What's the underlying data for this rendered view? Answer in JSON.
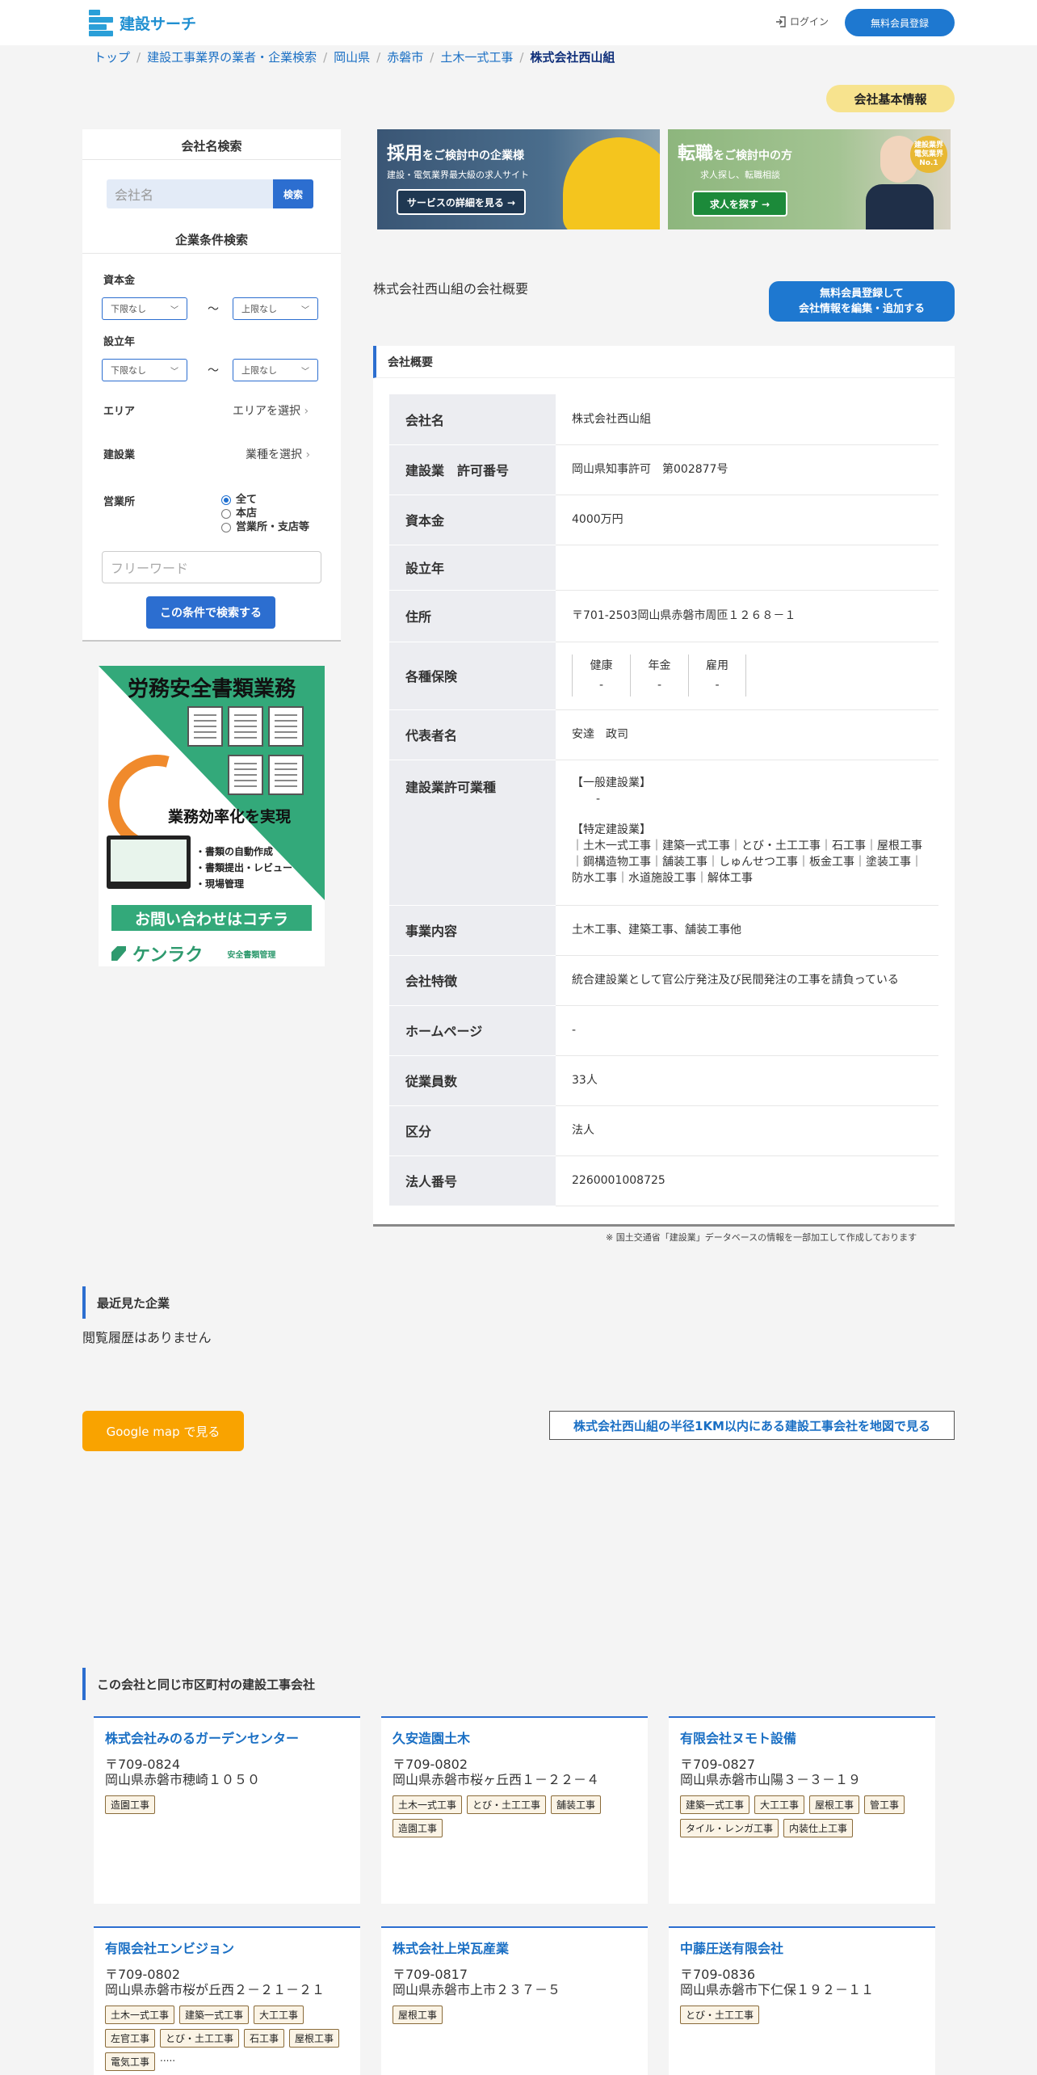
{
  "header": {
    "logo_text": "建設サーチ",
    "login_label": "ログイン",
    "register_label": "無料会員登録"
  },
  "breadcrumb": [
    "トップ",
    "建設工事業界の業者・企業検索",
    "岡山県",
    "赤磐市",
    "土木一式工事",
    "株式会社西山組"
  ],
  "info_pill": "会社基本情報",
  "sidebar": {
    "name_search_title": "会社名検索",
    "name_placeholder": "会社名",
    "name_search_btn": "検索",
    "cond_title": "企業条件検索",
    "capital_label": "資本金",
    "founded_label": "設立年",
    "lower_default": "下限なし",
    "upper_default": "上限なし",
    "tilde": "〜",
    "area_label": "エリア",
    "area_pick": "エリアを選択",
    "industry_label": "建設業",
    "industry_pick": "業種を選択",
    "office_label": "営業所",
    "office_options": [
      "全て",
      "本店",
      "営業所・支店等"
    ],
    "freeword_placeholder": "フリーワード",
    "search_btn": "この条件で検索する"
  },
  "ad": {
    "title": "労務安全書類業務",
    "efficiency": "業務効率化を実現",
    "bullets": [
      "・書類の自動作成",
      "・書類提出・レビュー",
      "・現場管理"
    ],
    "cta": "お問い合わせはコチラ",
    "brand": "ケンラク",
    "brand_sub": "安全書類管理"
  },
  "banners": [
    {
      "title_big": "採用",
      "title_rest": "をご検討中の企業様",
      "sub": "建設・電気業界最大級の求人サイト",
      "button": "サービスの詳細を見る →"
    },
    {
      "title_big": "転職",
      "title_rest": "をご検討中の方",
      "sub": "求人探し、転職相談",
      "button": "求人を探す →",
      "medal": "建設業界 電気業界 No.1"
    }
  ],
  "overview": {
    "title": "株式会社西山組の会社概要",
    "edit_btn_line1": "無料会員登録して",
    "edit_btn_line2": "会社情報を編集・追加する",
    "panel_title": "会社概要",
    "rows": [
      {
        "label": "会社名",
        "value": "株式会社西山組"
      },
      {
        "label": "建設業　許可番号",
        "value": "岡山県知事許可　第002877号"
      },
      {
        "label": "資本金",
        "value": "4000万円"
      },
      {
        "label": "設立年",
        "value": ""
      },
      {
        "label": "住所",
        "value": "〒701-2503岡山県赤磐市周匝１２６８－１"
      },
      {
        "label": "各種保険",
        "value": ""
      },
      {
        "label": "代表者名",
        "value": "安達　政司"
      },
      {
        "label": "建設業許可業種",
        "value": ""
      },
      {
        "label": "事業内容",
        "value": "土木工事、建築工事、舗装工事他"
      },
      {
        "label": "会社特徴",
        "value": "統合建設業として官公庁発注及び民間発注の工事を請負っている"
      },
      {
        "label": "ホームページ",
        "value": "-"
      },
      {
        "label": "従業員数",
        "value": "33人"
      },
      {
        "label": "区分",
        "value": "法人"
      },
      {
        "label": "法人番号",
        "value": "2260001008725"
      }
    ],
    "insurance": [
      {
        "name": "健康",
        "value": "-"
      },
      {
        "name": "年金",
        "value": "-"
      },
      {
        "name": "雇用",
        "value": "-"
      }
    ],
    "license": {
      "general_head": "【一般建設業】",
      "general_value": "-",
      "special_head": "【特定建設業】",
      "special_value": "｜土木一式工事｜建築一式工事｜とび・土工工事｜石工事｜屋根工事｜鋼構造物工事｜舗装工事｜しゅんせつ工事｜板金工事｜塗装工事｜防水工事｜水道施設工事｜解体工事"
    },
    "note": "※ 国土交通省「建設業」データベースの情報を一部加工して作成しております"
  },
  "recent": {
    "title": "最近見た企業",
    "empty": "閲覧履歴はありません"
  },
  "map": {
    "gmap_btn": "Google map で見る",
    "radius_link": "株式会社西山組の半径1KM以内にある建設工事会社を地図で見る"
  },
  "same_city": {
    "title": "この会社と同じ市区町村の建設工事会社",
    "companies": [
      {
        "name": "株式会社みのるガーデンセンター",
        "zip": "〒709-0824",
        "addr": "岡山県赤磐市穂崎１０５０",
        "tags": [
          "造園工事"
        ]
      },
      {
        "name": "久安造園土木",
        "zip": "〒709-0802",
        "addr": "岡山県赤磐市桜ヶ丘西１－２２－４",
        "tags": [
          "土木一式工事",
          "とび・土工工事",
          "舗装工事",
          "造園工事"
        ]
      },
      {
        "name": "有限会社ヌモト設備",
        "zip": "〒709-0827",
        "addr": "岡山県赤磐市山陽３－３－１９",
        "tags": [
          "建築一式工事",
          "大工工事",
          "屋根工事",
          "管工事",
          "タイル・レンガ工事",
          "内装仕上工事"
        ]
      },
      {
        "name": "有限会社エンビジョン",
        "zip": "〒709-0802",
        "addr": "岡山県赤磐市桜が丘西２－２１－２１",
        "tags": [
          "土木一式工事",
          "建築一式工事",
          "大工工事",
          "左官工事",
          "とび・土工工事",
          "石工事",
          "屋根工事",
          "電気工事"
        ],
        "more": "....."
      },
      {
        "name": "株式会社上栄瓦産業",
        "zip": "〒709-0817",
        "addr": "岡山県赤磐市上市２３７－５",
        "tags": [
          "屋根工事"
        ]
      },
      {
        "name": "中藤圧送有限会社",
        "zip": "〒709-0836",
        "addr": "岡山県赤磐市下仁保１９２－１１",
        "tags": [
          "とび・土工工事"
        ]
      }
    ]
  }
}
